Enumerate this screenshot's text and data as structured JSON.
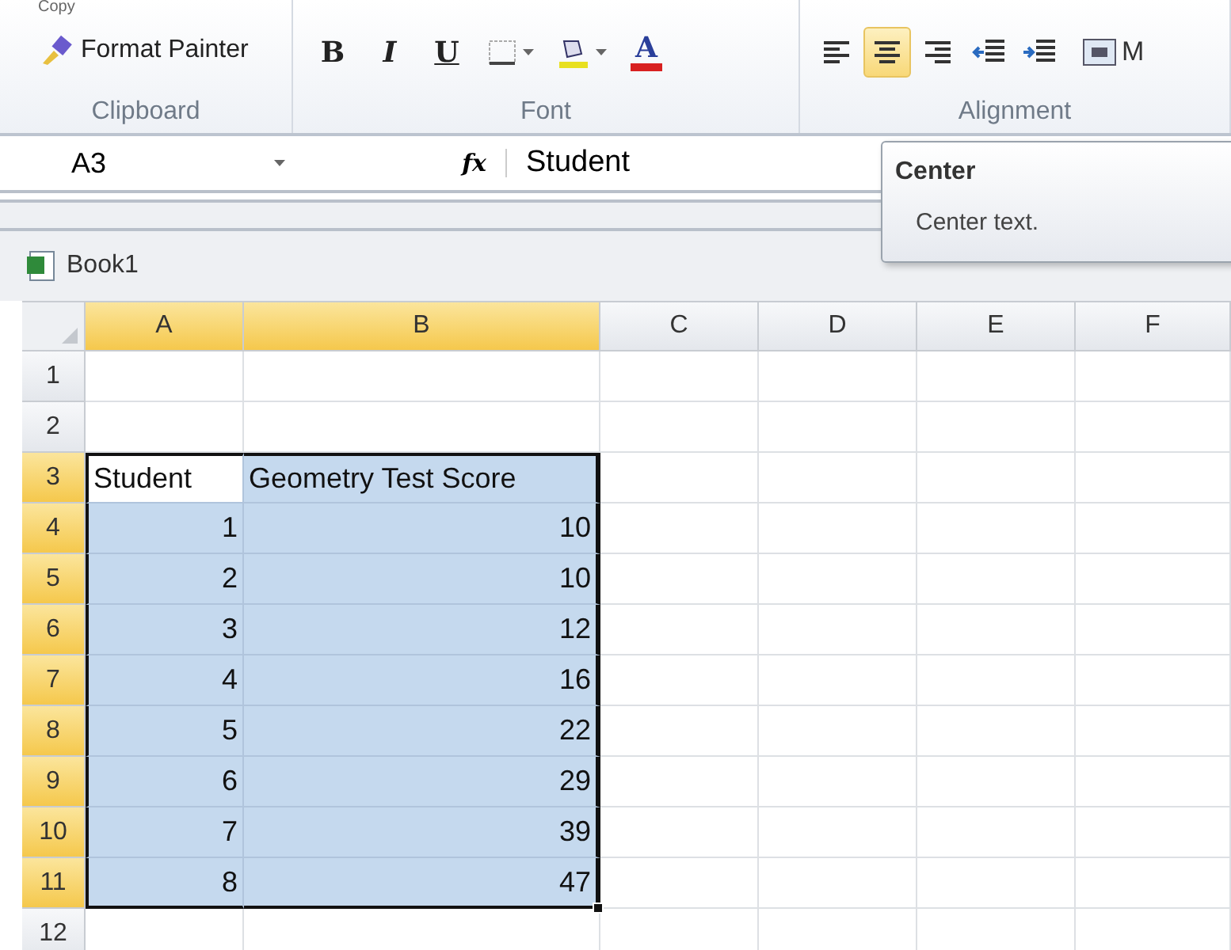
{
  "ribbon": {
    "groups": [
      {
        "kind": "clipboard",
        "label": "Clipboard",
        "copy": "Copy",
        "format_painter": "Format Painter"
      },
      {
        "kind": "font",
        "label": "Font",
        "buttons": [
          {
            "kind": "bold",
            "text": "B"
          },
          {
            "kind": "italic",
            "text": "I"
          },
          {
            "kind": "underline",
            "text": "U"
          },
          {
            "kind": "borders"
          },
          {
            "kind": "fill"
          },
          {
            "kind": "fontcolor",
            "text": "A"
          }
        ]
      },
      {
        "kind": "alignment",
        "label": "Alignment",
        "buttons": [
          {
            "kind": "left",
            "selected": false
          },
          {
            "kind": "center",
            "selected": true
          },
          {
            "kind": "right",
            "selected": false
          },
          {
            "kind": "outdent",
            "selected": false
          },
          {
            "kind": "indent",
            "selected": false
          }
        ],
        "merge": "M"
      }
    ]
  },
  "formula_bar": {
    "name_box": "A3",
    "function_label": "fx",
    "value": "Student"
  },
  "tooltip": {
    "title": "Center",
    "description": "Center text."
  },
  "workbook": {
    "title": "Book1"
  },
  "sheet": {
    "columns": [
      {
        "label": "A",
        "selected": true
      },
      {
        "label": "B",
        "selected": true
      },
      {
        "label": "C",
        "selected": false
      },
      {
        "label": "D",
        "selected": false
      },
      {
        "label": "E",
        "selected": false
      },
      {
        "label": "F",
        "selected": false
      }
    ],
    "rows": [
      {
        "number": "1",
        "selected": false
      },
      {
        "number": "2",
        "selected": false
      },
      {
        "number": "3",
        "selected": true,
        "cells": [
          {
            "text": "Student",
            "kind": "text",
            "active": true
          },
          {
            "text": "Geometry Test Score",
            "kind": "text",
            "active": false
          }
        ]
      },
      {
        "number": "4",
        "selected": true,
        "cells": [
          {
            "text": "1",
            "kind": "number",
            "active": false
          },
          {
            "text": "10",
            "kind": "number",
            "active": false
          }
        ]
      },
      {
        "number": "5",
        "selected": true,
        "cells": [
          {
            "text": "2",
            "kind": "number",
            "active": false
          },
          {
            "text": "10",
            "kind": "number",
            "active": false
          }
        ]
      },
      {
        "number": "6",
        "selected": true,
        "cells": [
          {
            "text": "3",
            "kind": "number",
            "active": false
          },
          {
            "text": "12",
            "kind": "number",
            "active": false
          }
        ]
      },
      {
        "number": "7",
        "selected": true,
        "cells": [
          {
            "text": "4",
            "kind": "number",
            "active": false
          },
          {
            "text": "16",
            "kind": "number",
            "active": false
          }
        ]
      },
      {
        "number": "8",
        "selected": true,
        "cells": [
          {
            "text": "5",
            "kind": "number",
            "active": false
          },
          {
            "text": "22",
            "kind": "number",
            "active": false
          }
        ]
      },
      {
        "number": "9",
        "selected": true,
        "cells": [
          {
            "text": "6",
            "kind": "number",
            "active": false
          },
          {
            "text": "29",
            "kind": "number",
            "active": false
          }
        ]
      },
      {
        "number": "10",
        "selected": true,
        "cells": [
          {
            "text": "7",
            "kind": "number",
            "active": false
          },
          {
            "text": "39",
            "kind": "number",
            "active": false
          }
        ]
      },
      {
        "number": "11",
        "selected": true,
        "cells": [
          {
            "text": "8",
            "kind": "number",
            "active": false
          },
          {
            "text": "47",
            "kind": "number",
            "active": false
          }
        ]
      },
      {
        "number": "12",
        "selected": false
      }
    ]
  }
}
